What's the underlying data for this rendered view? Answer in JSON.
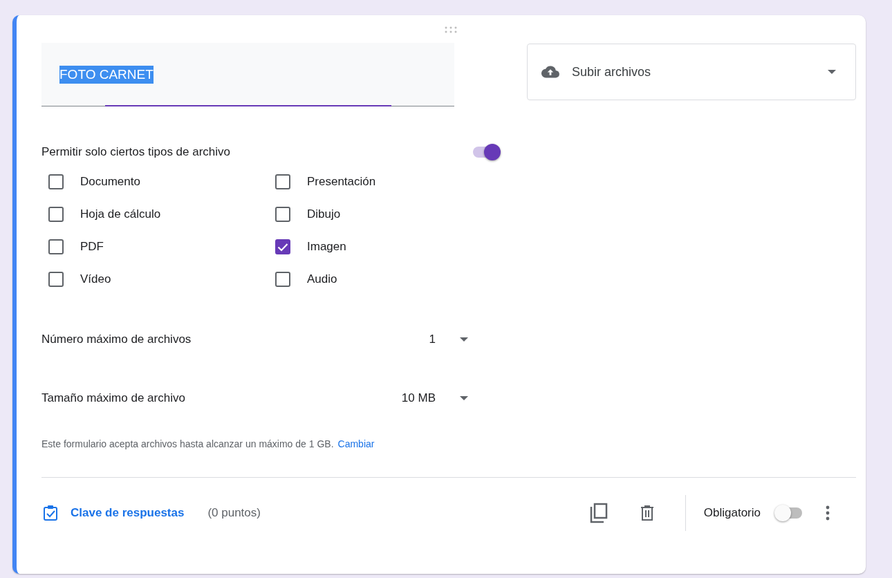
{
  "title_field": {
    "value": "FOTO CARNET"
  },
  "type_dropdown": {
    "label": "Subir archivos"
  },
  "file_types": {
    "label": "Permitir solo ciertos tipos de archivo",
    "on": true,
    "options": [
      {
        "label": "Documento",
        "checked": false
      },
      {
        "label": "Presentación",
        "checked": false
      },
      {
        "label": "Hoja de cálculo",
        "checked": false
      },
      {
        "label": "Dibujo",
        "checked": false
      },
      {
        "label": "PDF",
        "checked": false
      },
      {
        "label": "Imagen",
        "checked": true
      },
      {
        "label": "Vídeo",
        "checked": false
      },
      {
        "label": "Audio",
        "checked": false
      }
    ]
  },
  "limits": [
    {
      "label": "Número máximo de archivos",
      "value": "1"
    },
    {
      "label": "Tamaño máximo de archivo",
      "value": "10 MB"
    }
  ],
  "note": {
    "text": "Este formulario acepta archivos hasta alcanzar un máximo de 1 GB.",
    "link": "Cambiar"
  },
  "footer": {
    "answer_key": "Clave de respuestas",
    "points": "(0 puntos)",
    "required": {
      "label": "Obligatorio",
      "on": false
    }
  }
}
